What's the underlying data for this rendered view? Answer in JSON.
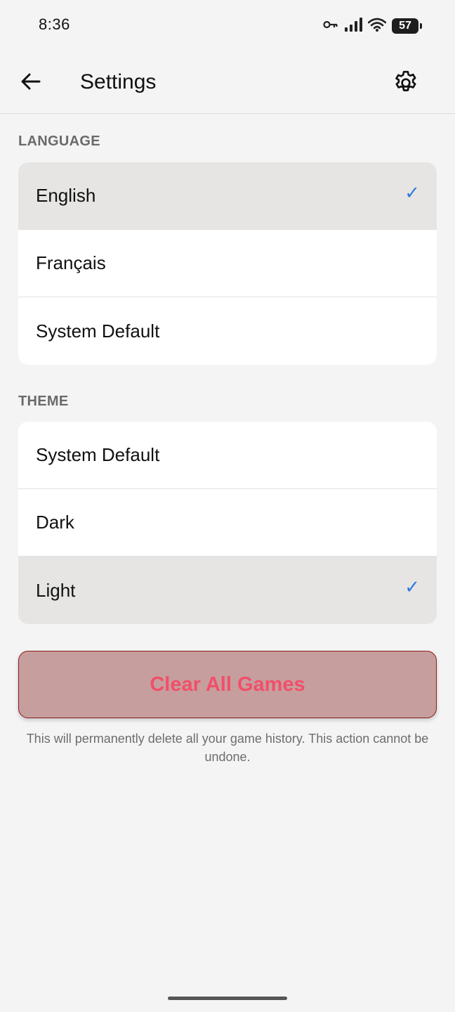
{
  "status_bar": {
    "time": "8:36",
    "battery": "57",
    "icons": [
      "key-icon",
      "signal-icon",
      "wifi-icon",
      "battery-icon"
    ]
  },
  "header": {
    "title": "Settings",
    "back_icon": "arrow-left-icon",
    "settings_icon": "gear-icon"
  },
  "language": {
    "label": "LANGUAGE",
    "options": [
      {
        "label": "English",
        "selected": true
      },
      {
        "label": "Français",
        "selected": false
      },
      {
        "label": "System Default",
        "selected": false
      }
    ]
  },
  "theme": {
    "label": "THEME",
    "options": [
      {
        "label": "System Default",
        "selected": false
      },
      {
        "label": "Dark",
        "selected": false
      },
      {
        "label": "Light",
        "selected": true
      }
    ]
  },
  "danger": {
    "button_label": "Clear All Games",
    "warning": "This will permanently delete all your game history. This action cannot be undone."
  },
  "colors": {
    "accent": "#2f7be0",
    "selected_bg": "#e6e5e4",
    "danger_bg": "#c79e9e",
    "danger_text": "#f0506a",
    "danger_border": "#8a1c1c"
  },
  "check_glyph": "✓"
}
